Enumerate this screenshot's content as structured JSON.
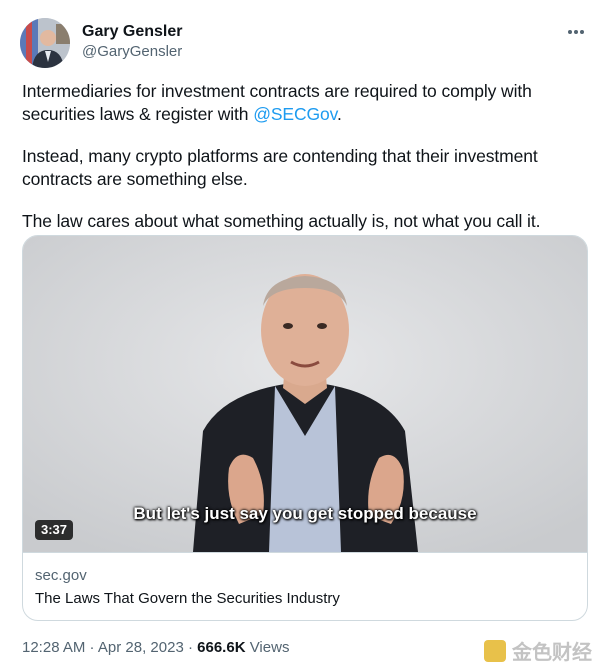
{
  "author": {
    "name": "Gary Gensler",
    "handle": "@GaryGensler"
  },
  "tweet": {
    "line1_before": "Intermediaries for investment contracts are required to comply with securities laws & register with ",
    "mention": "@SECGov",
    "line1_after": ".",
    "paragraph2": "Instead, many crypto platforms are contending that their investment contracts are something else.",
    "paragraph3": "The law cares about what something actually is, not what you call it."
  },
  "video": {
    "subtitle": "But let's just say you get stopped because",
    "duration": "3:37"
  },
  "card": {
    "domain": "sec.gov",
    "title": "The Laws That Govern the Securities Industry"
  },
  "footer": {
    "time": "12:28 AM",
    "separator": " · ",
    "date": "Apr 28, 2023",
    "views_count": "666.6K",
    "views_label": "Views"
  },
  "watermark": {
    "text": "金色财经"
  },
  "colors": {
    "accent": "#1d9bf0",
    "secondary_text": "#536471",
    "border": "#cfd9de"
  },
  "icons": {
    "more": "more-horizontal-icon"
  }
}
